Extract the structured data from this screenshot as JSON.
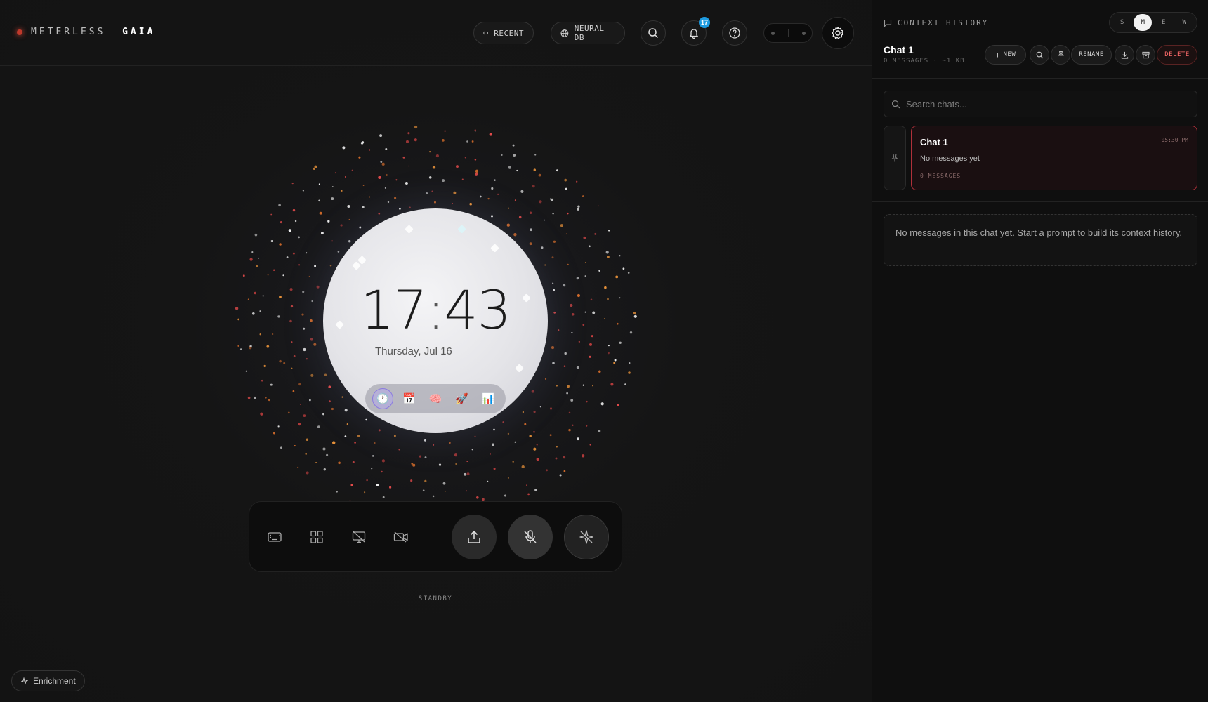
{
  "app": {
    "logo_light": "METERLESS",
    "logo_bold": "GAIA"
  },
  "topbar": {
    "recent_label": "RECENT",
    "neural_db_label": "NEURAL DB",
    "notification_count": "17"
  },
  "clock": {
    "hour": "17",
    "minute": "43",
    "date": "Thursday, Jul 16"
  },
  "dock": {
    "items": [
      "clock",
      "calendar",
      "brain",
      "rocket",
      "chart"
    ],
    "active_index": 0
  },
  "controls": {
    "status": "STANDBY"
  },
  "enrichment": {
    "label": "Enrichment"
  },
  "sidebar": {
    "header": "CONTEXT HISTORY",
    "sizes": [
      "S",
      "M",
      "E",
      "W"
    ],
    "active_size": "M",
    "chat_title": "Chat 1",
    "chat_meta": "0 MESSAGES · ~1 KB",
    "actions": {
      "new": "NEW",
      "rename": "RENAME",
      "delete": "DELETE"
    },
    "search_placeholder": "Search chats...",
    "chats": [
      {
        "title": "Chat 1",
        "time": "05:30 PM",
        "subtitle": "No messages yet",
        "count": "0 MESSAGES"
      }
    ],
    "empty_note": "No messages in this chat yet. Start a prompt to build its context history."
  },
  "colors": {
    "accent_red": "#b0303a",
    "badge_blue": "#1e9be0",
    "delete_red": "#ff6b6b"
  }
}
